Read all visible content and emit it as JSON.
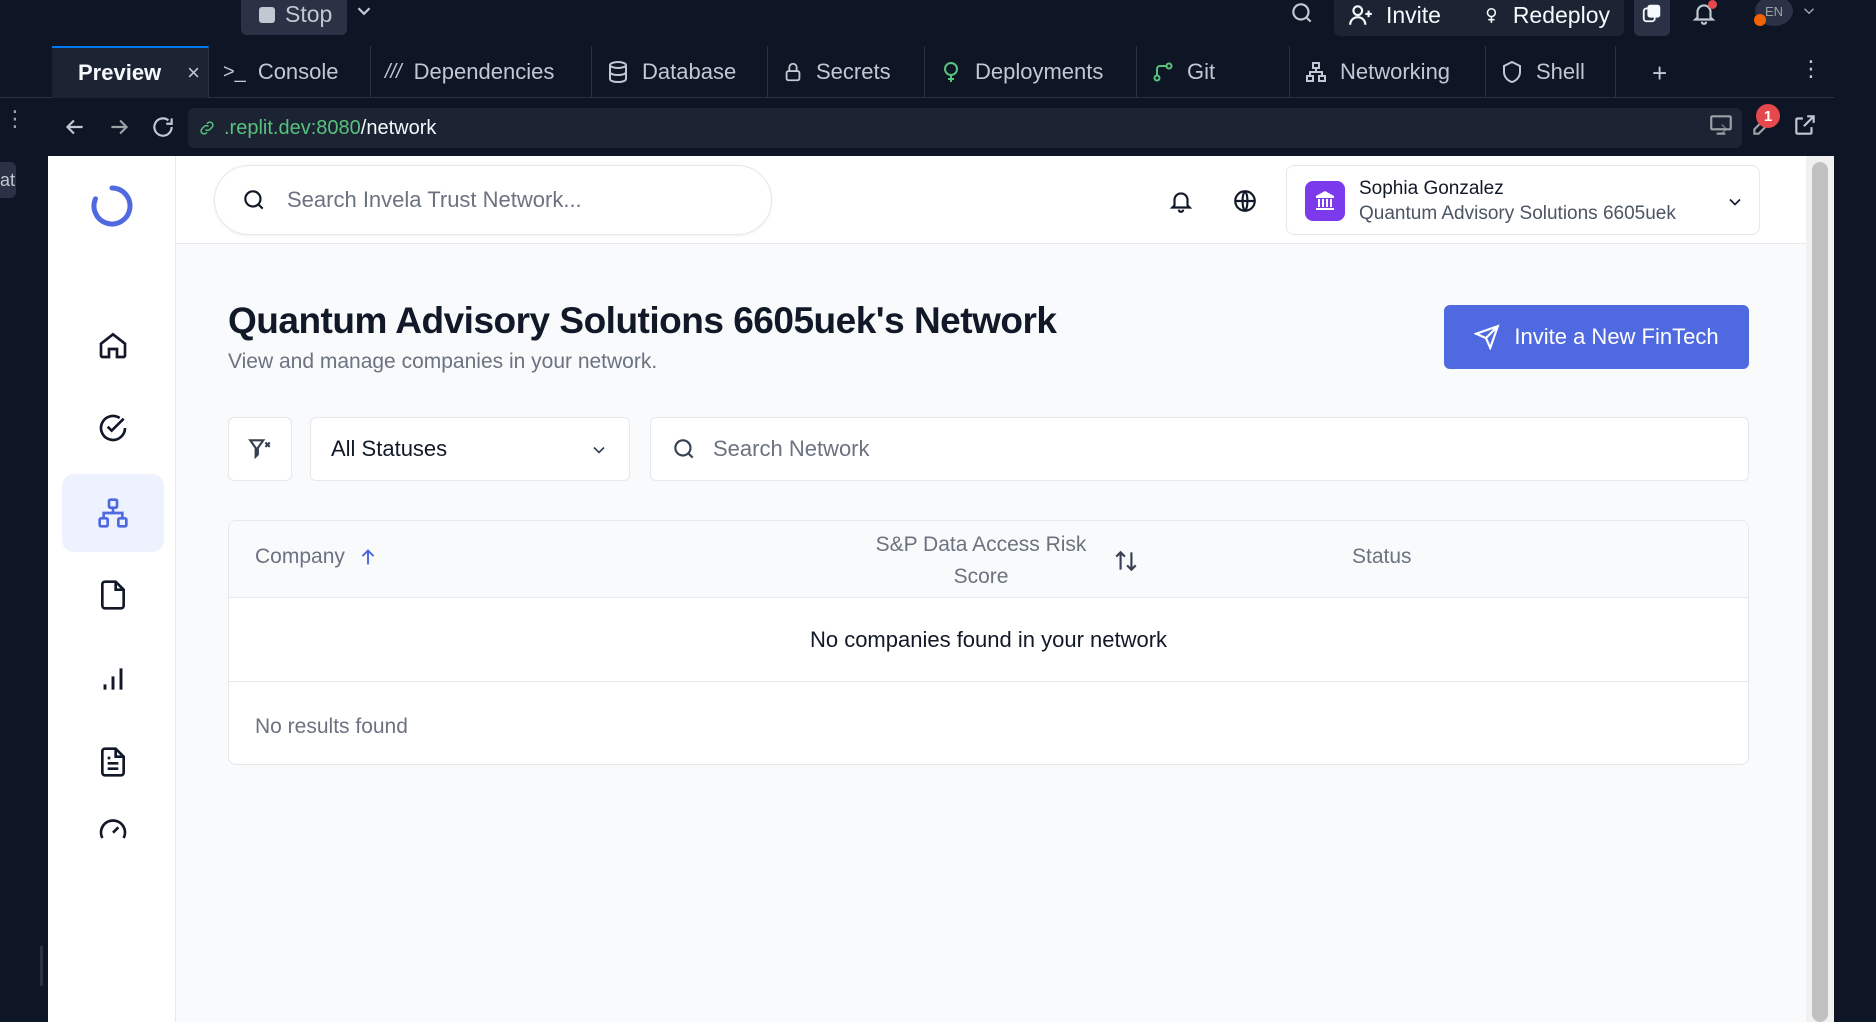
{
  "replit": {
    "stop_label": "Stop",
    "invite_label": "Invite",
    "redeploy_label": "Redeploy",
    "lang_label": "EN",
    "rail_label": "at",
    "tabs": [
      {
        "label": "Preview",
        "icon": "monitor-icon"
      },
      {
        "label": "Console",
        "icon": "terminal-icon"
      },
      {
        "label": "Dependencies",
        "icon": "dependencies-icon"
      },
      {
        "label": "Database",
        "icon": "database-icon"
      },
      {
        "label": "Secrets",
        "icon": "lock-icon"
      },
      {
        "label": "Deployments",
        "icon": "deployments-icon"
      },
      {
        "label": "Git",
        "icon": "git-icon"
      },
      {
        "label": "Networking",
        "icon": "networking-icon"
      },
      {
        "label": "Shell",
        "icon": "shell-icon"
      }
    ],
    "url": {
      "host": ".replit.dev:8080",
      "path": "/network"
    },
    "notification_count": "1"
  },
  "app": {
    "search_placeholder": "Search Invela Trust Network...",
    "user": {
      "name": "Sophia Gonzalez",
      "org": "Quantum Advisory Solutions 6605uek"
    },
    "page_title": "Quantum Advisory Solutions 6605uek's Network",
    "page_subtitle": "View and manage companies in your network.",
    "invite_button": "Invite a New FinTech",
    "status_filter": "All Statuses",
    "network_search_placeholder": "Search Network",
    "table": {
      "columns": [
        "Company",
        "S&P Data Access Risk Score",
        "Status"
      ],
      "empty_message": "No companies found in your network",
      "footer": "No results found"
    }
  },
  "colors": {
    "accent": "#4f6ae0",
    "replit_bg": "#0e1525",
    "green_url": "#58c27d"
  }
}
